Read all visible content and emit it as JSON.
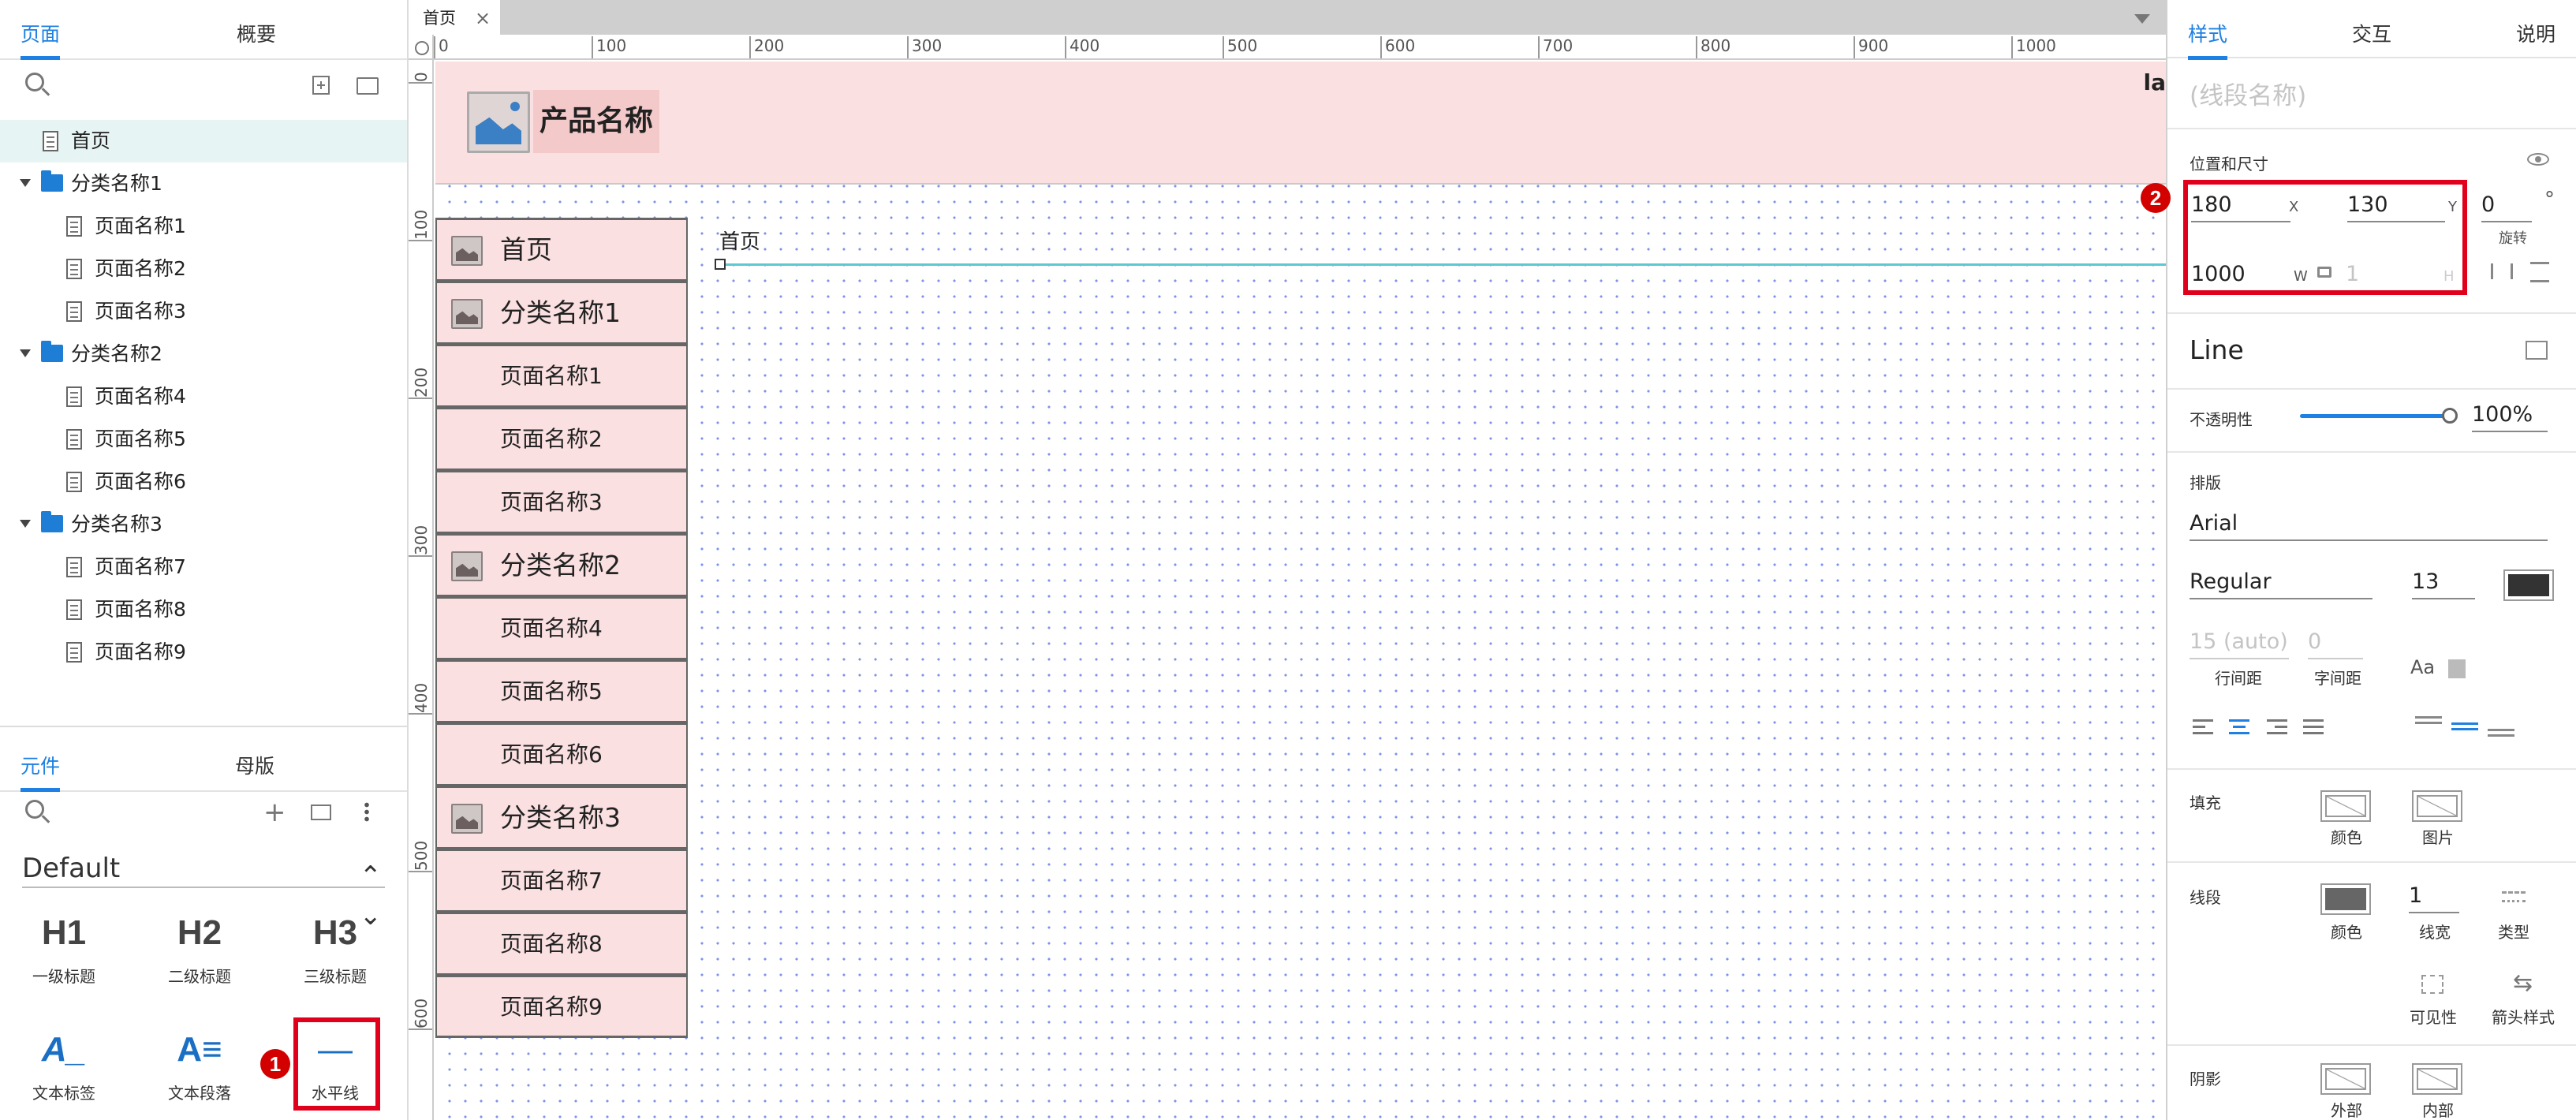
{
  "left": {
    "tabs": [
      "页面",
      "概要"
    ],
    "tree": [
      {
        "label": "首页",
        "type": "page",
        "depth": 0,
        "selected": true
      },
      {
        "label": "分类名称1",
        "type": "folder",
        "depth": 0
      },
      {
        "label": "页面名称1",
        "type": "page",
        "depth": 1
      },
      {
        "label": "页面名称2",
        "type": "page",
        "depth": 1
      },
      {
        "label": "页面名称3",
        "type": "page",
        "depth": 1
      },
      {
        "label": "分类名称2",
        "type": "folder",
        "depth": 0
      },
      {
        "label": "页面名称4",
        "type": "page",
        "depth": 1
      },
      {
        "label": "页面名称5",
        "type": "page",
        "depth": 1
      },
      {
        "label": "页面名称6",
        "type": "page",
        "depth": 1
      },
      {
        "label": "分类名称3",
        "type": "folder",
        "depth": 0
      },
      {
        "label": "页面名称7",
        "type": "page",
        "depth": 1
      },
      {
        "label": "页面名称8",
        "type": "page",
        "depth": 1
      },
      {
        "label": "页面名称9",
        "type": "page",
        "depth": 1
      }
    ],
    "lib_tabs": [
      "元件",
      "母版"
    ],
    "library_name": "Default",
    "widgets": [
      {
        "glyph": "H1",
        "label": "一级标题"
      },
      {
        "glyph": "H2",
        "label": "二级标题"
      },
      {
        "glyph": "H3",
        "label": "三级标题"
      },
      {
        "glyph": "A_",
        "label": "文本标签"
      },
      {
        "glyph": "A≡",
        "label": "文本段落"
      },
      {
        "glyph": "—",
        "label": "水平线"
      }
    ],
    "badge": "1"
  },
  "canvas": {
    "tab_label": "首页",
    "ruler_h": [
      "0",
      "100",
      "200",
      "300",
      "400",
      "500",
      "600",
      "700",
      "800",
      "900",
      "1000"
    ],
    "ruler_v": [
      "0",
      "100",
      "200",
      "300",
      "400",
      "500",
      "600"
    ],
    "product_name": "产品名称",
    "edge_text": "la",
    "nav": [
      {
        "label": "首页",
        "icon": true
      },
      {
        "label": "分类名称1",
        "icon": true
      },
      {
        "label": "页面名称1",
        "icon": false
      },
      {
        "label": "页面名称2",
        "icon": false
      },
      {
        "label": "页面名称3",
        "icon": false
      },
      {
        "label": "分类名称2",
        "icon": true
      },
      {
        "label": "页面名称4",
        "icon": false
      },
      {
        "label": "页面名称5",
        "icon": false
      },
      {
        "label": "页面名称6",
        "icon": false
      },
      {
        "label": "分类名称3",
        "icon": true
      },
      {
        "label": "页面名称7",
        "icon": false
      },
      {
        "label": "页面名称8",
        "icon": false
      },
      {
        "label": "页面名称9",
        "icon": false
      }
    ],
    "breadcrumb": "首页"
  },
  "right": {
    "tabs": [
      "样式",
      "交互",
      "说明"
    ],
    "name_placeholder": "(线段名称)",
    "pos_size_label": "位置和尺寸",
    "x": "180",
    "x_label": "X",
    "y": "130",
    "y_label": "Y",
    "rotation": "0",
    "rotation_unit": "°",
    "rotation_label": "旋转",
    "w": "1000",
    "w_label": "W",
    "h": "1",
    "h_label": "H",
    "badge": "2",
    "style_name": "Line",
    "opacity_label": "不透明性",
    "opacity_value": "100%",
    "opacity": 1.0,
    "typography_label": "排版",
    "font": "Arial",
    "font_weight": "Regular",
    "font_size": "13",
    "line_height": "15 (auto)",
    "letter_spacing": "0",
    "line_height_label": "行间距",
    "letter_spacing_label": "字间距",
    "aa_label": "Aa",
    "fill_label": "填充",
    "fill_color_label": "颜色",
    "fill_image_label": "图片",
    "border_label": "线段",
    "border_color_label": "颜色",
    "border_width": "1",
    "border_width_label": "线宽",
    "border_type_label": "类型",
    "visibility_label": "可见性",
    "arrow_label": "箭头样式",
    "shadow_label": "阴影",
    "shadow_outer_label": "外部",
    "shadow_inner_label": "内部",
    "accent": "#1d80e2",
    "highlight": "#e0001b"
  }
}
